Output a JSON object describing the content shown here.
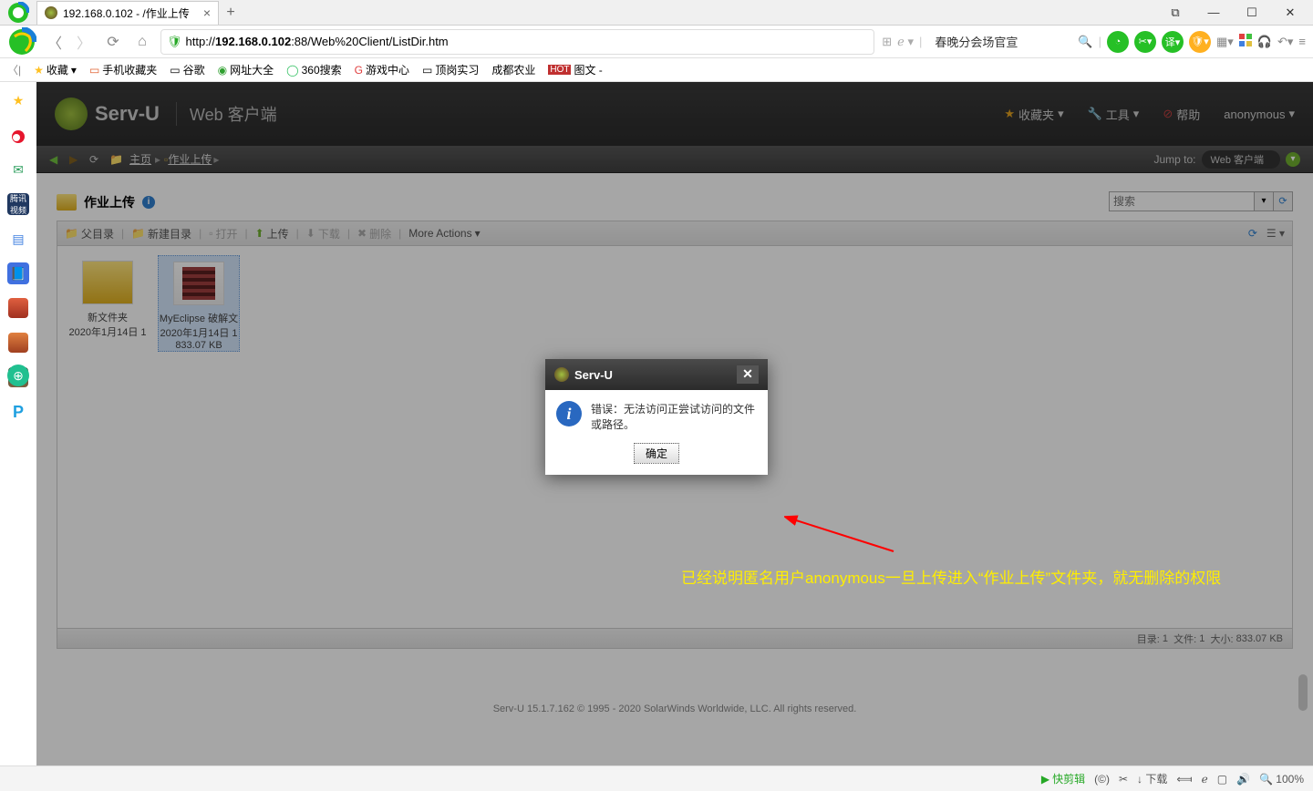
{
  "tab": {
    "title": "192.168.0.102 - /作业上传"
  },
  "url": {
    "prefix": "http://",
    "host": "192.168.0.102",
    "rest": ":88/Web%20Client/ListDir.htm"
  },
  "headline": "春晚分会场官宣",
  "bookmarks": {
    "fav": "收藏",
    "b1": "手机收藏夹",
    "b2": "谷歌",
    "b3": "网址大全",
    "b4": "360搜索",
    "b5": "游戏中心",
    "b6": "顶岗实习",
    "b7": "成都农业",
    "b8": "图文 -"
  },
  "servu": {
    "name": "Serv-U",
    "sub": "Web 客户端",
    "menu": {
      "fav": "收藏夹",
      "tools": "工具",
      "help": "帮助",
      "user": "anonymous"
    }
  },
  "crumbs": {
    "home": "主页",
    "current": "作业上传",
    "jump_label": "Jump to:",
    "jump_value": "Web 客户端"
  },
  "page": {
    "folder_title": "作业上传",
    "search_placeholder": "搜索",
    "toolbar": {
      "parent": "父目录",
      "newdir": "新建目录",
      "open": "打开",
      "upload": "上传",
      "download": "下载",
      "delete": "删除",
      "more": "More Actions"
    },
    "files": [
      {
        "name": "新文件夹",
        "date": "2020年1月14日 1",
        "size": ""
      },
      {
        "name": "MyEclipse 破解文",
        "date": "2020年1月14日 1",
        "size": "833.07 KB"
      }
    ],
    "status": {
      "dirs_label": "目录:",
      "dirs": "1",
      "files_label": "文件:",
      "files": "1",
      "size_label": "大小:",
      "size": "833.07 KB"
    },
    "copyright": "Serv-U 15.1.7.162 © 1995 - 2020 SolarWinds Worldwide, LLC. All rights reserved."
  },
  "dialog": {
    "title": "Serv-U",
    "message": "错误：无法访问正尝试访问的文件或路径。",
    "ok": "确定"
  },
  "annotation": "已经说明匿名用户anonymous一旦上传进入“作业上传”文件夹，就无删除的权限",
  "bottom": {
    "clip": "快剪辑",
    "download": "下载",
    "zoom": "100%"
  }
}
